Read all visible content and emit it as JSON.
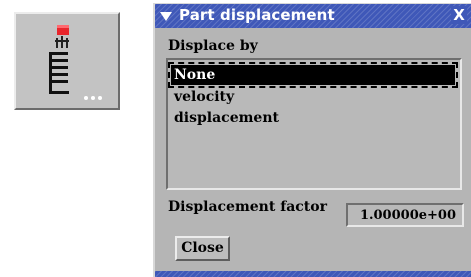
{
  "tool_button": {
    "icon": "part-displacement-icon"
  },
  "dialog": {
    "title": "Part displacement",
    "close_glyph": "X",
    "displace_by_label": "Displace by",
    "options": [
      {
        "label": "None",
        "selected": true
      },
      {
        "label": "velocity",
        "selected": false
      },
      {
        "label": "displacement",
        "selected": false
      }
    ],
    "factor_label": "Displacement factor",
    "factor_value": "1.00000e+00",
    "close_button": "Close"
  },
  "colors": {
    "titlebar": "#3f58b8",
    "dialog_bg": "#b5b5b5",
    "selection": "#000000",
    "icon_red": "#e8262c"
  }
}
